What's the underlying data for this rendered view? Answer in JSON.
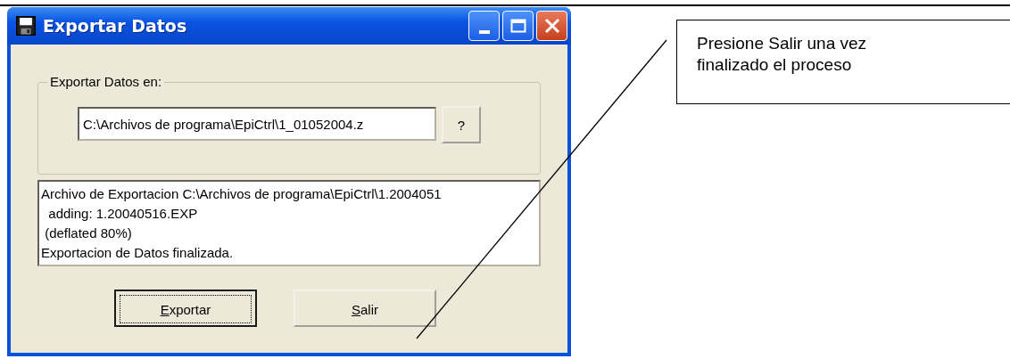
{
  "window": {
    "title": "Exportar Datos",
    "group": {
      "label": "Exportar Datos en:",
      "path_value": "C:\\Archivos de programa\\EpiCtrl\\1_01052004.z",
      "browse_button": "?"
    },
    "log_lines": [
      "Archivo de Exportacion C:\\Archivos de programa\\EpiCtrl\\1.2004051",
      "  adding: 1.20040516.EXP",
      " (deflated 80%)",
      "Exportacion de Datos finalizada."
    ],
    "buttons": [
      {
        "label": "Exportar",
        "focused": true
      },
      {
        "label": "Salir",
        "focused": false
      }
    ]
  },
  "callout": {
    "text": "Presione Salir una vez finalizado el proceso"
  }
}
